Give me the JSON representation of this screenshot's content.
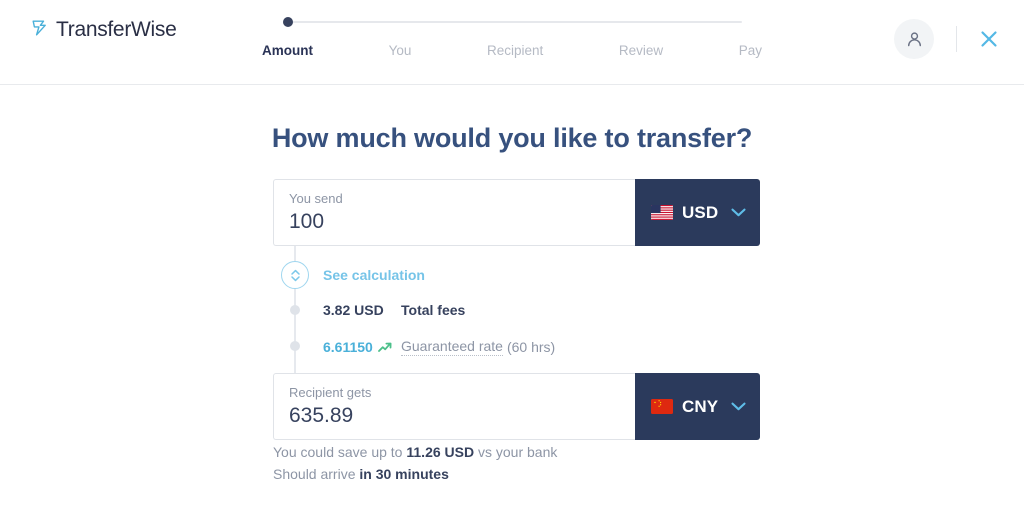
{
  "header": {
    "logo_text": "TransferWise",
    "logo_icon": "transferwise-arrow-logo",
    "avatar_icon": "person-icon",
    "close_icon": "close-x-icon"
  },
  "stepper": {
    "active_index": 0,
    "steps": [
      {
        "label": "Amount"
      },
      {
        "label": "You"
      },
      {
        "label": "Recipient"
      },
      {
        "label": "Review"
      },
      {
        "label": "Pay"
      }
    ]
  },
  "main": {
    "title": "How much would you like to transfer?"
  },
  "send": {
    "label": "You send",
    "value": "100",
    "currency": "USD",
    "flag": "us-flag-icon",
    "chevron_icon": "chevron-down-icon"
  },
  "calculation": {
    "toggle_icon": "updown-chevrons-icon",
    "see_calculation": "See calculation",
    "fees": {
      "amount": "3.82 USD",
      "description": "Total fees"
    },
    "rate": {
      "amount": "6.61150",
      "trend_icon": "trend-up-icon",
      "description": "Guaranteed rate",
      "duration": "(60 hrs)"
    }
  },
  "receive": {
    "label": "Recipient gets",
    "value": "635.89",
    "currency": "CNY",
    "flag": "cn-flag-icon",
    "chevron_icon": "chevron-down-icon"
  },
  "notes": {
    "save_prefix": "You could save up to ",
    "save_amount": "11.26 USD",
    "save_suffix": " vs your bank",
    "arrive_prefix": "Should arrive ",
    "arrive_time": "in 30 minutes"
  },
  "colors": {
    "brand_navy": "#2b3a5c",
    "title_navy": "#37517e",
    "accent_blue": "#76c4e8",
    "text_dark": "#37425e",
    "text_muted": "#8d95a5",
    "border": "#e0e3e8"
  }
}
